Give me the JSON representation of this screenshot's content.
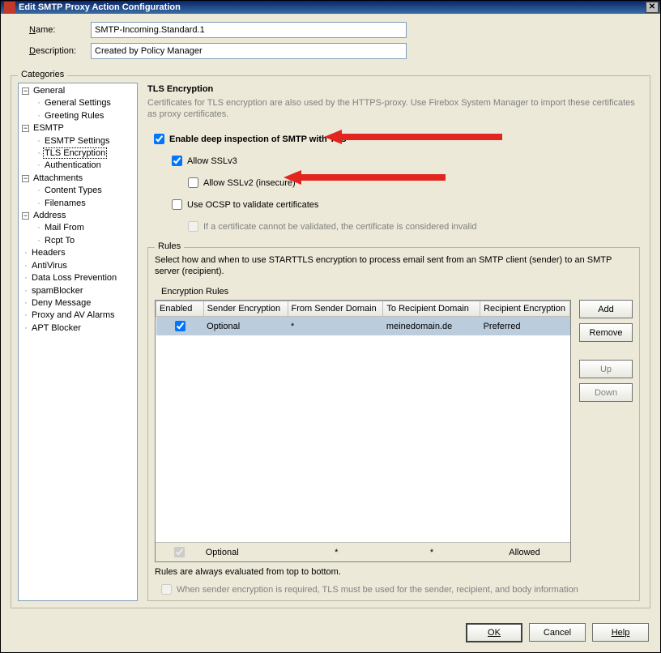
{
  "window": {
    "title": "Edit SMTP Proxy Action Configuration"
  },
  "form": {
    "name_label": "Name:",
    "name_value": "SMTP-Incoming.Standard.1",
    "desc_label": "Description:",
    "desc_value": "Created by Policy Manager"
  },
  "categories_legend": "Categories",
  "tree": {
    "general": "General",
    "general_settings": "General Settings",
    "greeting_rules": "Greeting Rules",
    "esmtp": "ESMTP",
    "esmtp_settings": "ESMTP Settings",
    "tls_encryption": "TLS Encryption",
    "authentication": "Authentication",
    "attachments": "Attachments",
    "content_types": "Content Types",
    "filenames": "Filenames",
    "address": "Address",
    "mail_from": "Mail From",
    "rcpt_to": "Rcpt To",
    "headers": "Headers",
    "antivirus": "AntiVirus",
    "dlp": "Data Loss Prevention",
    "spamblocker": "spamBlocker",
    "deny_message": "Deny Message",
    "proxy_alarms": "Proxy and AV Alarms",
    "apt_blocker": "APT Blocker"
  },
  "tls": {
    "title": "TLS Encryption",
    "desc": "Certificates for TLS encryption are also used by the HTTPS-proxy. Use Firebox System Manager to import these certificates as proxy certificates.",
    "enable_label": "Enable deep inspection of SMTP with TLS",
    "sslv3_label": "Allow SSLv3",
    "sslv2_label": "Allow SSLv2 (insecure)",
    "ocsp_label": "Use OCSP to validate certificates",
    "ocsp_sub": "If a certificate cannot be validated, the certificate is considered invalid"
  },
  "rules": {
    "legend": "Rules",
    "desc": "Select how and when to use STARTTLS encryption to process email sent from an SMTP client (sender) to an SMTP server (recipient).",
    "label": "Encryption Rules",
    "cols": {
      "enabled": "Enabled",
      "sender_enc": "Sender Encryption",
      "from_domain": "From Sender Domain",
      "to_domain": "To Recipient Domain",
      "recipient_enc": "Recipient Encryption"
    },
    "rows": [
      {
        "enabled": true,
        "sender_enc": "Optional",
        "from_domain": "*",
        "to_domain": "meinedomain.de",
        "recipient_enc": "Preferred"
      }
    ],
    "default_row": {
      "sender_enc": "Optional",
      "from_domain": "*",
      "to_domain": "*",
      "recipient_enc": "Allowed"
    },
    "footer_note": "Rules are always evaluated from top to bottom.",
    "footer_chk": "When sender encryption is required, TLS must be used for the sender, recipient, and body information"
  },
  "buttons": {
    "add": "Add",
    "remove": "Remove",
    "up": "Up",
    "down": "Down",
    "ok": "OK",
    "cancel": "Cancel",
    "help": "Help"
  }
}
